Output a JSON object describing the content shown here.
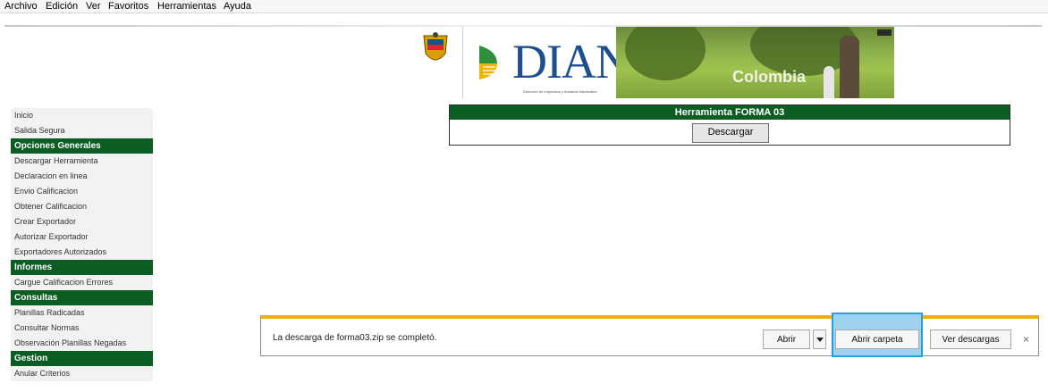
{
  "menu": [
    "Archivo",
    "Edición",
    "Ver",
    "Favoritos",
    "Herramientas",
    "Ayuda"
  ],
  "banner": {
    "logo_text": "DIAN",
    "logo_subtitle": "Dirección de Impuestos y Aduanas Nacionales",
    "photo_caption": "Colombia"
  },
  "sidebar": {
    "items": [
      {
        "type": "link",
        "label": "Inicio"
      },
      {
        "type": "link",
        "label": "Salida Segura"
      },
      {
        "type": "header",
        "label": "Opciones Generales"
      },
      {
        "type": "link",
        "label": "Descargar Herramienta"
      },
      {
        "type": "link",
        "label": "Declaracion en linea"
      },
      {
        "type": "link",
        "label": "Envio Calificacion"
      },
      {
        "type": "link",
        "label": "Obtener Calificacion"
      },
      {
        "type": "link",
        "label": "Crear Exportador"
      },
      {
        "type": "link",
        "label": "Autorizar Exportador"
      },
      {
        "type": "link",
        "label": "Exportadores Autorizados"
      },
      {
        "type": "header",
        "label": "Informes"
      },
      {
        "type": "link",
        "label": "Cargue Calificacion Errores"
      },
      {
        "type": "header",
        "label": "Consultas"
      },
      {
        "type": "link",
        "label": "Planillas Radicadas"
      },
      {
        "type": "link",
        "label": "Consultar Normas"
      },
      {
        "type": "link",
        "label": "Observación Planillas Negadas"
      },
      {
        "type": "header",
        "label": "Gestion"
      },
      {
        "type": "link",
        "label": "Anular Criterios"
      }
    ]
  },
  "tool": {
    "title": "Herramienta FORMA 03",
    "download_label": "Descargar"
  },
  "download_bar": {
    "message": "La descarga de forma03.zip se completó.",
    "open_label": "Abrir",
    "open_folder_label": "Abrir carpeta",
    "view_downloads_label": "Ver descargas",
    "close_glyph": "×"
  },
  "colors": {
    "green": "#0b5d24",
    "highlight": "#9fd2ef",
    "notification_bar": "#f0b400"
  }
}
